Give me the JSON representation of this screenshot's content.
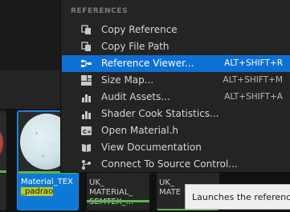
{
  "context_menu": {
    "section_header": "REFERENCES",
    "items": [
      {
        "label": "Copy Reference",
        "shortcut": "",
        "icon": "copy-icon"
      },
      {
        "label": "Copy File Path",
        "shortcut": "",
        "icon": "copy-path-icon"
      },
      {
        "label": "Reference Viewer...",
        "shortcut": "ALT+SHIFT+R",
        "icon": "reference-viewer-icon"
      },
      {
        "label": "Size Map...",
        "shortcut": "ALT+SHIFT+M",
        "icon": "size-map-icon"
      },
      {
        "label": "Audit Assets...",
        "shortcut": "ALT+SHIFT+A",
        "icon": "audit-icon"
      },
      {
        "label": "Shader Cook Statistics...",
        "shortcut": "",
        "icon": "statistics-icon"
      },
      {
        "label": "Open Material.h",
        "shortcut": "",
        "icon": "source-file-icon"
      },
      {
        "label": "View Documentation",
        "shortcut": "",
        "icon": "book-icon"
      },
      {
        "label": "Connect To Source Control...",
        "shortcut": "",
        "icon": "source-control-icon"
      }
    ],
    "active_index": 2
  },
  "assets": {
    "material": {
      "name_part1": "Material_TEX",
      "name_part2": "_padrao"
    },
    "semtex": {
      "name_line1": "UK_",
      "name_line2": "MATERIAL_",
      "name_line3": "SEMTEX_..."
    },
    "third": {
      "name_line1": "UK_",
      "name_line2": "MATE"
    }
  },
  "tooltip": {
    "text": "Launches the reference"
  },
  "colors": {
    "menu_background": "#242424",
    "highlight": "#0d70d4",
    "selected_tile": "#0d79d6",
    "asset_bar_green": "#54b848"
  }
}
